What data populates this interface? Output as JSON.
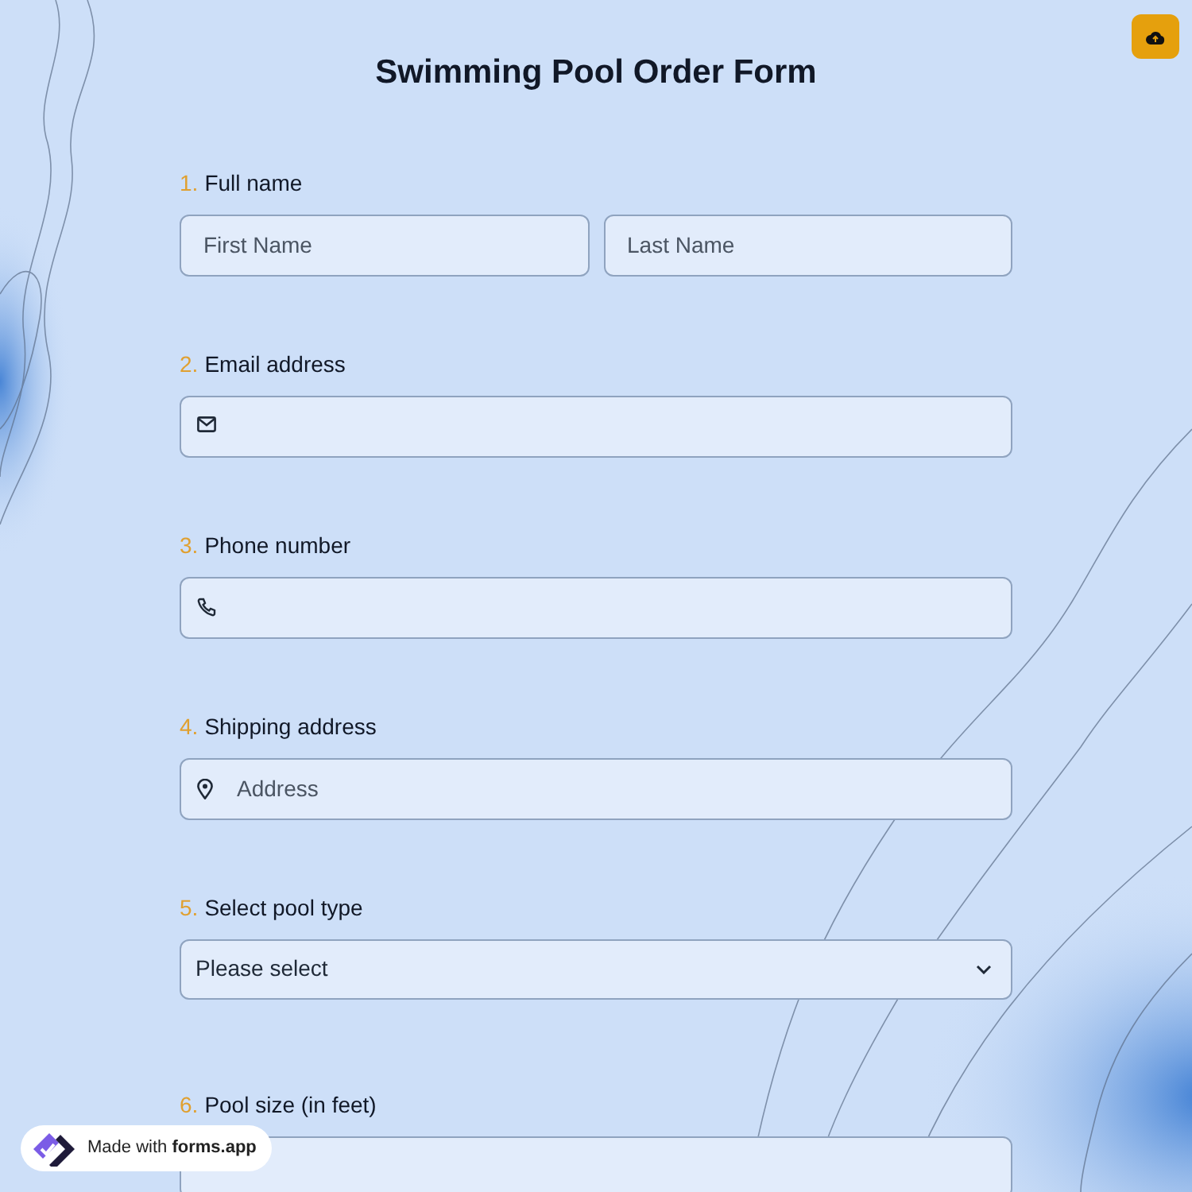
{
  "title": "Swimming Pool Order Form",
  "upload_button": {
    "kind": "cloud-upload"
  },
  "questions": [
    {
      "number": "1.",
      "label": "Full name",
      "kind": "name",
      "fields": [
        {
          "placeholder": "First Name"
        },
        {
          "placeholder": "Last Name"
        }
      ]
    },
    {
      "number": "2.",
      "label": "Email address",
      "kind": "email"
    },
    {
      "number": "3.",
      "label": "Phone number",
      "kind": "phone"
    },
    {
      "number": "4.",
      "label": "Shipping address",
      "kind": "address",
      "placeholder": "Address"
    },
    {
      "number": "5.",
      "label": "Select pool type",
      "kind": "select",
      "value": "Please select"
    },
    {
      "number": "6.",
      "label": "Pool size (in feet)",
      "kind": "text"
    }
  ],
  "badge": {
    "text": "Made with **forms.app**"
  }
}
